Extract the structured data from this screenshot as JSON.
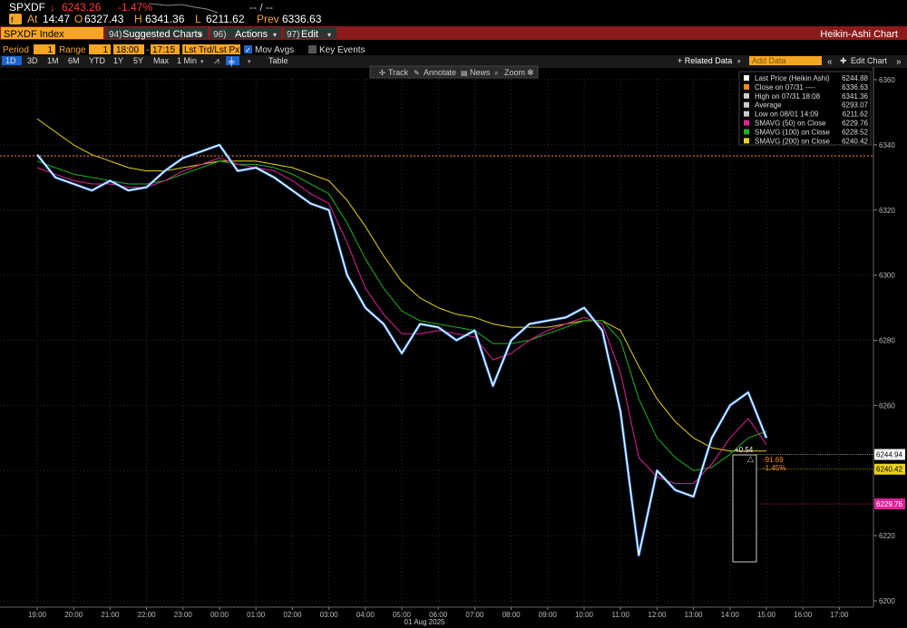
{
  "header": {
    "ticker": "SPXDF",
    "last_price": "6243.26",
    "change_pct": "-1.47%",
    "dashes": "-- / --",
    "at_label": "At",
    "time": "14:47",
    "o_label": "O",
    "open": "6327.43",
    "h_label": "H",
    "high": "6341.36",
    "l_label": "L",
    "low": "6211.62",
    "prev_label": "Prev",
    "prev": "6336.63",
    "ticker_icon": "fire-icon"
  },
  "toolbar": {
    "security": "SPXDF Index",
    "suggested_num": "94)",
    "suggested": "Suggested Charts",
    "actions_num": "96)",
    "actions": "Actions",
    "edit_num": "97)",
    "edit": "Edit",
    "chart_type": "Heikin-Ashi Chart"
  },
  "params": {
    "period_label": "Period",
    "period_value": "1",
    "range_label": "Range",
    "range_value": "1",
    "time_from": "18:00",
    "time_to": "17:15",
    "trd_label": "Lst Trd/Lst Px",
    "mov_avgs": "Mov Avgs",
    "key_events": "Key Events"
  },
  "periods": {
    "items": [
      "1D",
      "3D",
      "1M",
      "6M",
      "YTD",
      "1Y",
      "5Y",
      "Max"
    ],
    "active": "1D",
    "interval": "1 Min",
    "table": "Table",
    "related": "+ Related Data",
    "add_data": "Add Data",
    "edit_chart": "Edit Chart"
  },
  "chart_toolbar": {
    "track": "Track",
    "annotate": "Annotate",
    "news": "News",
    "zoom": "Zoom"
  },
  "legend": [
    {
      "label": "Last Price (Heikin Ashi)",
      "value": "6244.88",
      "color": "#ffffff"
    },
    {
      "label": "Close on 07/31 ----",
      "value": "6336.63",
      "color": "#ff8c1a"
    },
    {
      "label": "High on 07/31 18:08",
      "value": "6341.36",
      "color": "#cccccc"
    },
    {
      "label": "Average",
      "value": "6293.07",
      "color": "#cccccc"
    },
    {
      "label": "Low on 08/01 14:09",
      "value": "6211.62",
      "color": "#cccccc"
    },
    {
      "label": "SMAVG (50)  on Close",
      "value": "6229.76",
      "color": "#e0219a"
    },
    {
      "label": "SMAVG (100)  on Close",
      "value": "6228.52",
      "color": "#22b022"
    },
    {
      "label": "SMAVG (200)  on Close",
      "value": "6240.42",
      "color": "#e8d21e"
    }
  ],
  "annotations": {
    "high_change": "+0.54",
    "low_change_abs": "-91.69",
    "low_change_pct": "-1.45%"
  },
  "price_tags": [
    {
      "value": "6244.94",
      "bg": "#ffffff",
      "fg": "#000000"
    },
    {
      "value": "6240.42",
      "bg": "#e8d21e",
      "fg": "#000000"
    },
    {
      "value": "6229.76",
      "bg": "#e0219a",
      "fg": "#ffffff"
    }
  ],
  "chart_data": {
    "type": "line",
    "title": "",
    "xlabel": "",
    "ylabel": "",
    "date_label": "01 Aug 2025",
    "x_ticks": [
      "19:00",
      "20:00",
      "21:00",
      "22:00",
      "23:00",
      "00:00",
      "01:00",
      "02:00",
      "03:00",
      "04:00",
      "05:00",
      "06:00",
      "07:00",
      "08:00",
      "09:00",
      "10:00",
      "11:00",
      "12:00",
      "13:00",
      "14:00",
      "15:00",
      "16:00",
      "17:00"
    ],
    "y_ticks": [
      6200,
      6220,
      6240,
      6260,
      6280,
      6300,
      6320,
      6340,
      6360
    ],
    "ylim": [
      6200,
      6363
    ],
    "reference_line": {
      "name": "Close on 07/31",
      "value": 6336.63
    },
    "x_hours": [
      0,
      0.5,
      1,
      1.5,
      2,
      2.5,
      3,
      3.5,
      4,
      4.5,
      5,
      5.5,
      6,
      6.5,
      7,
      7.5,
      8,
      8.5,
      9,
      9.5,
      10,
      10.5,
      11,
      11.5,
      12,
      12.5,
      13,
      13.5,
      14,
      14.5,
      15,
      15.5,
      16,
      16.5,
      17,
      17.5,
      18,
      18.5,
      19,
      19.5,
      20
    ],
    "x_labels_note": "hours since 18:00 on 31 Jul",
    "series": [
      {
        "name": "Last Price (Heikin Ashi)",
        "color": "#ffffff",
        "values": [
          6337,
          6330,
          6328,
          6326,
          6329,
          6326,
          6327,
          6332,
          6336,
          6338,
          6340,
          6332,
          6333,
          6330,
          6326,
          6322,
          6320,
          6300,
          6290,
          6285,
          6276,
          6285,
          6284,
          6280,
          6283,
          6266,
          6280,
          6285,
          6286,
          6287,
          6290,
          6283,
          6258,
          6214,
          6240,
          6234,
          6232,
          6250,
          6260,
          6264,
          6250
        ]
      },
      {
        "name": "SMAVG (50)",
        "color": "#e0219a",
        "values": [
          6333,
          6331,
          6329,
          6328,
          6328,
          6327,
          6327,
          6329,
          6332,
          6334,
          6336,
          6334,
          6333,
          6332,
          6329,
          6325,
          6322,
          6310,
          6296,
          6288,
          6282,
          6282,
          6283,
          6282,
          6281,
          6274,
          6276,
          6280,
          6283,
          6285,
          6287,
          6285,
          6270,
          6244,
          6238,
          6236,
          6236,
          6242,
          6250,
          6256,
          6248
        ]
      },
      {
        "name": "SMAVG (100)",
        "color": "#22b022",
        "values": [
          6335,
          6333,
          6331,
          6330,
          6329,
          6328,
          6328,
          6329,
          6331,
          6333,
          6335,
          6334,
          6334,
          6333,
          6331,
          6328,
          6325,
          6316,
          6305,
          6296,
          6289,
          6286,
          6285,
          6284,
          6283,
          6279,
          6279,
          6280,
          6282,
          6284,
          6286,
          6286,
          6280,
          6262,
          6250,
          6244,
          6240,
          6241,
          6245,
          6250,
          6252
        ]
      },
      {
        "name": "SMAVG (200)",
        "color": "#e8d21e",
        "values": [
          6348,
          6344,
          6340,
          6337,
          6335,
          6333,
          6332,
          6332,
          6333,
          6334,
          6335,
          6335,
          6335,
          6334,
          6333,
          6331,
          6329,
          6323,
          6315,
          6306,
          6298,
          6293,
          6290,
          6288,
          6287,
          6285,
          6284,
          6284,
          6284,
          6285,
          6286,
          6286,
          6283,
          6272,
          6262,
          6255,
          6250,
          6247,
          6246,
          6246,
          6246
        ]
      }
    ]
  }
}
